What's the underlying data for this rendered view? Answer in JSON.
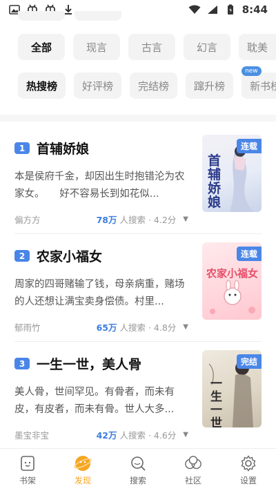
{
  "status_bar": {
    "time": "8:44",
    "left_icons": [
      "image-icon",
      "bug-icon",
      "bug-icon",
      "download-icon"
    ],
    "right_icons": [
      "wifi-icon",
      "signal-icon",
      "battery-icon"
    ]
  },
  "filters": {
    "categories": [
      {
        "label": "全部",
        "active": true
      },
      {
        "label": "现言",
        "active": false
      },
      {
        "label": "古言",
        "active": false
      },
      {
        "label": "幻言",
        "active": false
      },
      {
        "label": "耽美",
        "active": false
      }
    ],
    "rankings": [
      {
        "label": "热搜榜",
        "active": true,
        "badge": ""
      },
      {
        "label": "好评榜",
        "active": false,
        "badge": ""
      },
      {
        "label": "完结榜",
        "active": false,
        "badge": ""
      },
      {
        "label": "蹿升榜",
        "active": false,
        "badge": ""
      },
      {
        "label": "新书榜",
        "active": false,
        "badge": "new"
      }
    ]
  },
  "books": [
    {
      "rank": "1",
      "title": "首辅娇娘",
      "desc": "本是侯府千金，却因出生时抱错沦为农家女。　　好不容易长到如花似...",
      "author": "偏方方",
      "searches": "78万",
      "searches_label": "人搜索 · 4.2分",
      "status": "连载",
      "cover_text": "首辅娇娘"
    },
    {
      "rank": "2",
      "title": "农家小福女",
      "desc": "周家的四哥赌输了钱，母亲病重，赌场的人还想让满宝卖身偿债。村里...",
      "author": "郁雨竹",
      "searches": "65万",
      "searches_label": "人搜索 · 4.8分",
      "status": "连载",
      "cover_text": "农家小福女"
    },
    {
      "rank": "3",
      "title": "一生一世，美人骨",
      "desc": "美人骨，世间罕见。有骨者，而未有皮，有皮者，而未有骨。世人大多...",
      "author": "墨宝非宝",
      "searches": "42万",
      "searches_label": "人搜索 · 4.6分",
      "status": "完结",
      "cover_text": "一生一世"
    }
  ],
  "bottom_nav": [
    {
      "label": "书架",
      "icon": "bookshelf-icon",
      "active": false
    },
    {
      "label": "发现",
      "icon": "discover-icon",
      "active": true
    },
    {
      "label": "搜索",
      "icon": "search-icon",
      "active": false
    },
    {
      "label": "社区",
      "icon": "community-icon",
      "active": false
    },
    {
      "label": "设置",
      "icon": "settings-icon",
      "active": false
    }
  ],
  "colors": {
    "accent_blue": "#4a86e8",
    "nav_active": "#f5a623"
  }
}
